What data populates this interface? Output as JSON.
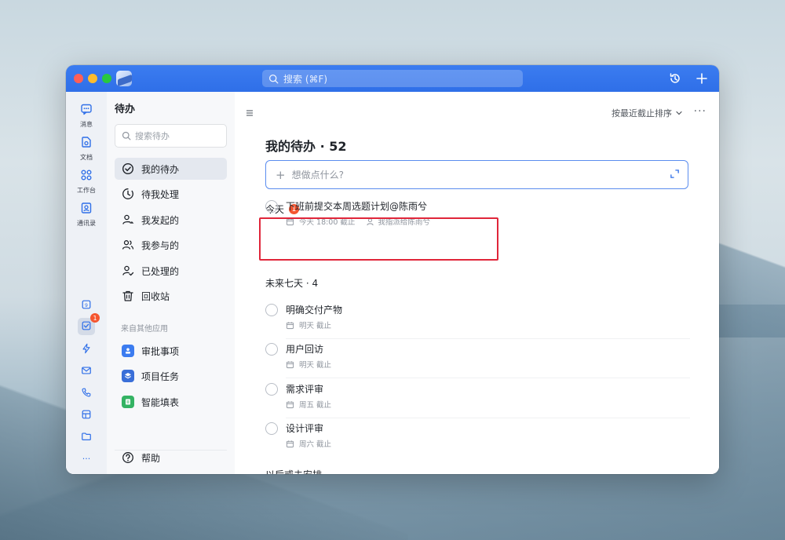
{
  "titlebar": {
    "search_placeholder": "搜索 (⌘F)"
  },
  "rail": {
    "items": [
      {
        "label": "消息",
        "icon": "chat-icon"
      },
      {
        "label": "文档",
        "icon": "docs-icon"
      },
      {
        "label": "工作台",
        "icon": "workbench-icon"
      },
      {
        "label": "通讯录",
        "icon": "contacts-icon"
      }
    ],
    "todo_badge": "1",
    "more": "···"
  },
  "sidebar": {
    "title": "待办",
    "search_placeholder": "搜索待办",
    "nav": [
      {
        "label": "我的待办",
        "icon": "check-circle-icon"
      },
      {
        "label": "待我处理",
        "icon": "clock-icon"
      },
      {
        "label": "我发起的",
        "icon": "user-send-icon"
      },
      {
        "label": "我参与的",
        "icon": "users-icon"
      },
      {
        "label": "已处理的",
        "icon": "user-check-icon"
      },
      {
        "label": "回收站",
        "icon": "trash-icon"
      }
    ],
    "other_apps_label": "来自其他应用",
    "apps": [
      {
        "label": "审批事项",
        "icon": "approval-icon",
        "color": "#3c7cf0"
      },
      {
        "label": "项目任务",
        "icon": "project-icon",
        "color": "#3a6fd8"
      },
      {
        "label": "智能填表",
        "icon": "form-icon",
        "color": "#34b363"
      }
    ],
    "help": "帮助"
  },
  "main": {
    "sort_label": "按最近截止排序",
    "more": "···",
    "title": "我的待办 · 52",
    "new_task_placeholder": "想做点什么?",
    "groups": {
      "today": {
        "label": "今天",
        "badge": "1"
      },
      "next7": {
        "label": "未来七天 · 4"
      },
      "later": {
        "label": "以后或未安排"
      }
    },
    "today_task": {
      "title": "下班前提交本周选题计划@陈雨兮",
      "due": "今天 18:00 截止",
      "assign": "我指派给陈雨兮"
    },
    "next7_tasks": [
      {
        "title": "明确交付产物",
        "due": "明天 截止"
      },
      {
        "title": "用户回访",
        "due": "明天 截止"
      },
      {
        "title": "需求评审",
        "due": "周五 截止"
      },
      {
        "title": "设计评审",
        "due": "周六 截止"
      }
    ]
  },
  "colors": {
    "accent": "#3b7cf0",
    "badge": "#f5552f",
    "highlight": "#e0263a"
  }
}
